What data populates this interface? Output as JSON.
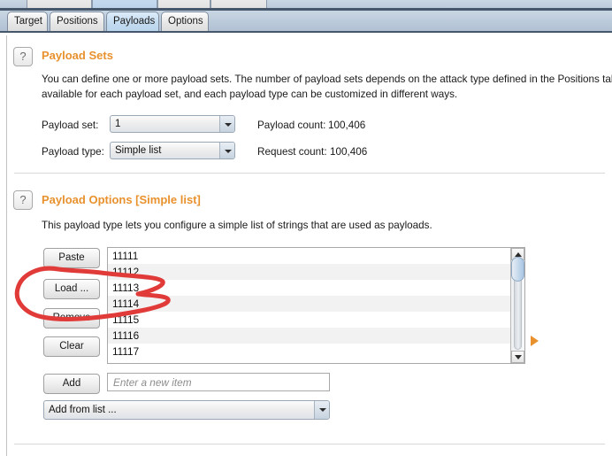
{
  "window": {
    "clipped_top_tabs": [
      "",
      "",
      "",
      ""
    ]
  },
  "tabs": [
    {
      "label": "Target",
      "active": false
    },
    {
      "label": "Positions",
      "active": false
    },
    {
      "label": "Payloads",
      "active": true
    },
    {
      "label": "Options",
      "active": false
    }
  ],
  "payload_sets": {
    "help_icon": "question-mark-icon",
    "title": "Payload Sets",
    "description_line1": "You can define one or more payload sets. The number of payload sets depends on the attack type defined in the Positions tab",
    "description_line2": "available for each payload set, and each payload type can be customized in different ways.",
    "payload_set_label": "Payload set:",
    "payload_set_value": "1",
    "payload_type_label": "Payload type:",
    "payload_type_value": "Simple list",
    "payload_count_label": "Payload count:",
    "payload_count_value": "100,406",
    "request_count_label": "Request count:",
    "request_count_value": "100,406"
  },
  "payload_options": {
    "help_icon": "question-mark-icon",
    "title": "Payload Options [Simple list]",
    "description": "This payload type lets you configure a simple list of strings that are used as payloads.",
    "buttons": [
      {
        "label": "Paste",
        "name": "paste-button"
      },
      {
        "label": "Load ...",
        "name": "load-button"
      },
      {
        "label": "Remove",
        "name": "remove-button"
      },
      {
        "label": "Clear",
        "name": "clear-button"
      }
    ],
    "list_items": [
      "11111",
      "11112",
      "11113",
      "11114",
      "11115",
      "11116",
      "11117"
    ],
    "add_button_label": "Add",
    "add_input_placeholder": "Enter a new item",
    "add_input_value": "",
    "add_from_list_value": "Add from list ..."
  },
  "annotation": {
    "type": "hand-drawn-red-ellipse",
    "target": "Load ...",
    "color": "#e03b39"
  },
  "colors": {
    "accent_orange": "#e8912d",
    "tab_active_blue": "#c3dbf0",
    "annotation_red": "#e03b39",
    "row_stripe": "#f2f2f2"
  }
}
